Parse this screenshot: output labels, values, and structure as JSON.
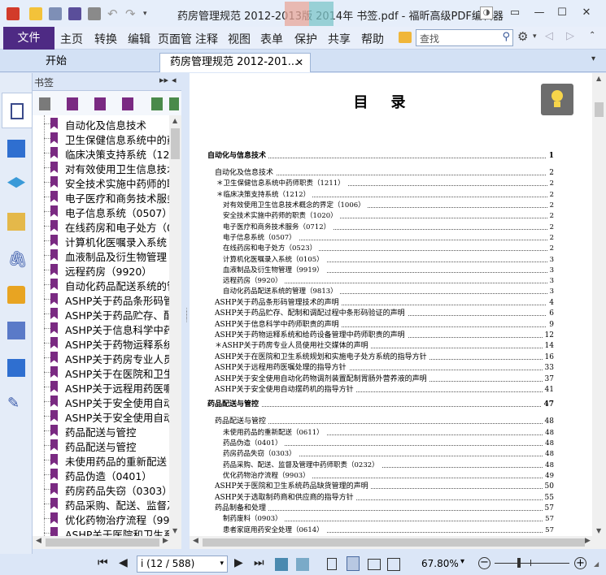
{
  "window": {
    "title": "药房管理规范 2012-2013版 2014年 书签.pdf - 福昕高级PDF编辑器"
  },
  "menu": {
    "file": "文件",
    "items": [
      "主页",
      "转换",
      "编辑",
      "页面管",
      "注释",
      "视图",
      "表单",
      "保护",
      "共享",
      "帮助"
    ],
    "search_placeholder": "查找"
  },
  "tabs": [
    {
      "label": "开始"
    },
    {
      "label": "药房管理规范 2012-201..."
    }
  ],
  "bookmarks": {
    "title": "书签",
    "items": [
      "自动化及信息技术",
      "卫生保健信息系统中的药",
      "临床决策支持系统（1212",
      "对有效使用卫生信息技术",
      "安全技术实施中药师的职",
      "电子医疗和商务技术服务",
      "电子信息系统（0507）",
      "在线药房和电子处方（0",
      "计算机化医嘱录入系统（",
      "血液制品及衍生物管理（",
      "远程药房（9920）",
      "自动化药品配送系统的管",
      "ASHP关于药品条形码管",
      "ASHP关于药品贮存、配",
      "ASHP关于信息科学中药",
      "ASHP关于药物运释系统",
      "ASHP关于药房专业人员",
      "ASHP关于在医院和卫生",
      "ASHP关于远程用药医嘱",
      "ASHP关于安全使用自动",
      "ASHP关于安全使用自动",
      "药品配送与管控",
      "药品配送与管控",
      "未使用药品的重新配送（",
      "药品伪造（0401）",
      "药房药品失窃（0303）",
      "药品采购、配送、监督及",
      "优化药物治疗流程（990",
      "ASHP关于医院和卫生系"
    ]
  },
  "document": {
    "title": "目录",
    "toc": [
      {
        "text": "自动化与信息技术",
        "page": "1",
        "level": 0
      },
      {
        "text": "自动化及信息技术",
        "page": "2",
        "level": 1
      },
      {
        "text": "＊卫生保健信息系统中药师职责（1211）",
        "page": "2",
        "level": 2
      },
      {
        "text": "＊临床决策支持系统（1212）",
        "page": "2",
        "level": 2
      },
      {
        "text": "对有效使用卫生信息技术概念的界定（1006）",
        "page": "2",
        "level": 3
      },
      {
        "text": "安全技术实施中药师的职责（1020）",
        "page": "2",
        "level": 3
      },
      {
        "text": "电子医疗和商务技术服务（0712）",
        "page": "2",
        "level": 3
      },
      {
        "text": "电子信息系统（0507）",
        "page": "2",
        "level": 3
      },
      {
        "text": "在线药房和电子处方（0523）",
        "page": "2",
        "level": 3
      },
      {
        "text": "计算机化医嘱录入系统（0105）",
        "page": "3",
        "level": 3
      },
      {
        "text": "血液制品及衍生物管理（9919）",
        "page": "3",
        "level": 3
      },
      {
        "text": "远程药房（9920）",
        "page": "3",
        "level": 3
      },
      {
        "text": "自动化药品配送系统的管理（9813）",
        "page": "3",
        "level": 3
      },
      {
        "text": "ASHP关于药品条形码管理技术的声明",
        "page": "4",
        "level": 1
      },
      {
        "text": "ASHP关于药品贮存、配制和调配过程中条形码验证的声明",
        "page": "6",
        "level": 1
      },
      {
        "text": "ASHP关于信息科学中药师职责的声明",
        "page": "9",
        "level": 1
      },
      {
        "text": "ASHP关于药物运释系统和给药设备管理中药师职责的声明",
        "page": "12",
        "level": 1
      },
      {
        "text": "＊ASHP关于药房专业人员使用社交媒体的声明",
        "page": "14",
        "level": 1
      },
      {
        "text": "ASHP关于在医院和卫生系统规划和实施电子处方系统的指导方针",
        "page": "16",
        "level": 1
      },
      {
        "text": "ASHP关于远程用药医嘱处理的指导方针",
        "page": "33",
        "level": 1
      },
      {
        "text": "ASHP关于安全使用自动化药物调剂装置配制胃肠外营养液的声明",
        "page": "37",
        "level": 1
      },
      {
        "text": "ASHP关于安全使用自动摆药机的指导方针",
        "page": "41",
        "level": 1
      },
      {
        "text": "药品配送与管控",
        "page": "47",
        "level": 0
      },
      {
        "text": "药品配送与管控",
        "page": "48",
        "level": 1
      },
      {
        "text": "未使用药品的重新配送（0611）",
        "page": "48",
        "level": 3
      },
      {
        "text": "药品伪造（0401）",
        "page": "48",
        "level": 3
      },
      {
        "text": "药房药品失窃（0303）",
        "page": "48",
        "level": 3
      },
      {
        "text": "药品采购、配送、监督及管理中药师职责（0232）",
        "page": "48",
        "level": 3
      },
      {
        "text": "优化药物治疗流程（9903）",
        "page": "49",
        "level": 3
      },
      {
        "text": "ASHP关于医院和卫生系统药品缺货管理的声明",
        "page": "50",
        "level": 1
      },
      {
        "text": "ASHP关于选取制药商和供应商的指导方针",
        "page": "55",
        "level": 1
      },
      {
        "text": "药品制备和处理",
        "page": "57",
        "level": 1
      },
      {
        "text": "制药废料（0903）",
        "page": "57",
        "level": 3
      },
      {
        "text": "患者家庭用药安全处理（0614）",
        "page": "57",
        "level": 3
      }
    ]
  },
  "status": {
    "page_indicator": "i (12 / 588)",
    "zoom": "67.80%"
  }
}
